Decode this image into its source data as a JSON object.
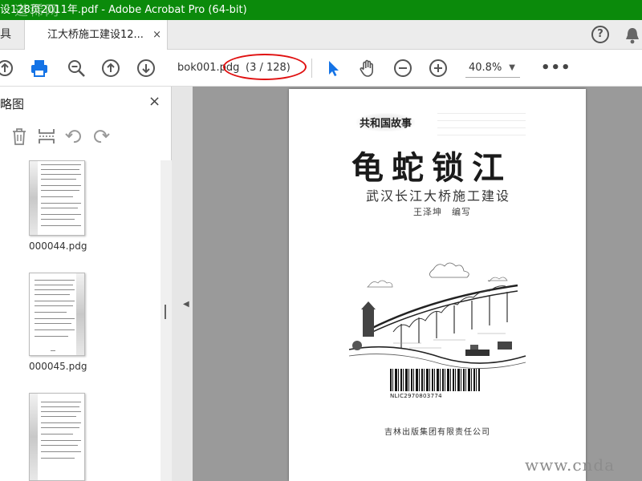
{
  "window": {
    "title": "设128页2011年.pdf - Adobe Acrobat Pro (64-bit)",
    "top_watermark": "道稀网"
  },
  "tabs": {
    "home_label": "具",
    "doc_tab_label": "江大桥施工建设12...",
    "close_glyph": "×",
    "help_glyph": "?"
  },
  "toolbar": {
    "filename": "bok001.pdg",
    "page_display": "(3 / 128)",
    "zoom": "40.8%",
    "more": "•••"
  },
  "panel": {
    "title": "略图",
    "close_glyph": "×"
  },
  "thumbnails": [
    {
      "label": "000044.pdg"
    },
    {
      "label": "000045.pdg"
    },
    {
      "label": ""
    }
  ],
  "page": {
    "series": "共和国故事",
    "title": "龟蛇锁江",
    "subtitle": "武汉长江大桥施工建设",
    "author": "王泽坤　编写",
    "barcode": "NLIC2970803774",
    "publisher": "吉林出版集团有限责任公司"
  },
  "bottom_watermark": "www.cnda",
  "colors": {
    "titlebar": "#0b8a0b",
    "accent_blue": "#1473e6",
    "annotation_red": "#e01010"
  }
}
